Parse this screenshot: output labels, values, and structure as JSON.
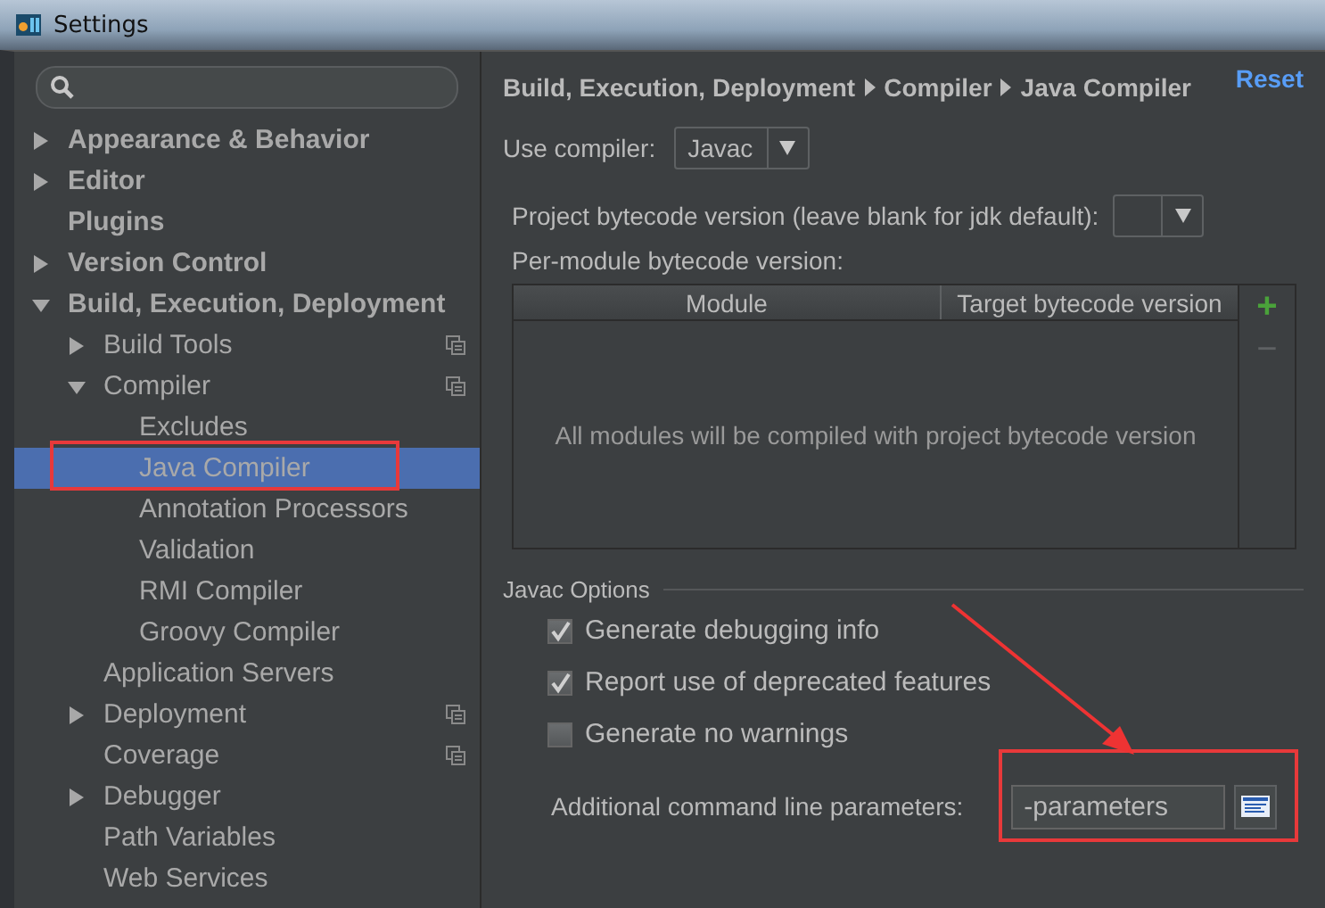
{
  "window": {
    "title": "Settings"
  },
  "sidebar": {
    "tree": [
      {
        "label": "Appearance & Behavior",
        "kind": "folder",
        "expanded": false,
        "selected": false,
        "highlighted": false,
        "project_icon": false
      },
      {
        "label": "Editor",
        "kind": "folder",
        "expanded": false,
        "selected": false,
        "highlighted": false,
        "project_icon": false
      },
      {
        "label": "Plugins",
        "kind": "page",
        "selected": false,
        "highlighted": false,
        "project_icon": false
      },
      {
        "label": "Version Control",
        "kind": "folder",
        "expanded": false,
        "selected": false,
        "highlighted": false,
        "project_icon": false
      },
      {
        "label": "Build, Execution, Deployment",
        "kind": "folder",
        "expanded": true,
        "selected": false,
        "highlighted": false,
        "project_icon": false,
        "children": [
          {
            "label": "Build Tools",
            "kind": "folder",
            "expanded": false,
            "selected": false,
            "highlighted": false,
            "project_icon": true
          },
          {
            "label": "Compiler",
            "kind": "folder",
            "expanded": true,
            "selected": false,
            "highlighted": false,
            "project_icon": true,
            "children": [
              {
                "label": "Excludes",
                "kind": "page",
                "selected": false,
                "highlighted": false,
                "project_icon": false
              },
              {
                "label": "Java Compiler",
                "kind": "page",
                "selected": true,
                "highlighted": true,
                "project_icon": false
              },
              {
                "label": "Annotation Processors",
                "kind": "page",
                "selected": false,
                "highlighted": false,
                "project_icon": false
              },
              {
                "label": "Validation",
                "kind": "page",
                "selected": false,
                "highlighted": false,
                "project_icon": false
              },
              {
                "label": "RMI Compiler",
                "kind": "page",
                "selected": false,
                "highlighted": false,
                "project_icon": false
              },
              {
                "label": "Groovy Compiler",
                "kind": "page",
                "selected": false,
                "highlighted": false,
                "project_icon": false
              }
            ]
          },
          {
            "label": "Application Servers",
            "kind": "page",
            "selected": false,
            "highlighted": false,
            "project_icon": false
          },
          {
            "label": "Deployment",
            "kind": "folder",
            "expanded": false,
            "selected": false,
            "highlighted": false,
            "project_icon": true
          },
          {
            "label": "Coverage",
            "kind": "page",
            "selected": false,
            "highlighted": false,
            "project_icon": true
          },
          {
            "label": "Debugger",
            "kind": "folder",
            "expanded": false,
            "selected": false,
            "highlighted": false,
            "project_icon": false
          },
          {
            "label": "Path Variables",
            "kind": "page",
            "selected": false,
            "highlighted": false,
            "project_icon": false
          },
          {
            "label": "Web Services",
            "kind": "page",
            "selected": false,
            "highlighted": false,
            "project_icon": false
          }
        ]
      }
    ]
  },
  "main": {
    "breadcrumb": [
      "Build, Execution, Deployment",
      "Compiler",
      "Java Compiler"
    ],
    "reset": "Reset",
    "use_compiler": {
      "label": "Use compiler:",
      "value": "Javac"
    },
    "project_bytecode": {
      "label": "Project bytecode version (leave blank for jdk default):"
    },
    "per_module_label": "Per-module bytecode version:",
    "table": {
      "columns": [
        "Module",
        "Target bytecode version"
      ],
      "empty_text": "All modules will be compiled with project bytecode version",
      "add": "+",
      "remove": "−"
    },
    "javac_options": {
      "title": "Javac Options",
      "checkboxes": [
        {
          "label": "Generate debugging info",
          "checked": true
        },
        {
          "label": "Report use of deprecated features",
          "checked": true
        },
        {
          "label": "Generate no warnings",
          "checked": false
        }
      ],
      "parameters": {
        "label": "Additional command line parameters:",
        "value": "-parameters",
        "highlighted": true
      }
    }
  }
}
